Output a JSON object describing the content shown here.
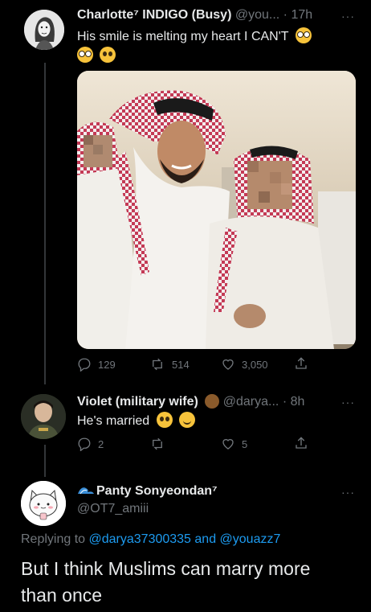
{
  "tweets": [
    {
      "author": "Charlotte⁷ INDIGO (Busy)",
      "handle": "@you...",
      "sep": "·",
      "time": "17h",
      "text": "His smile is melting my heart I CAN'T",
      "text_emojis": [
        "nerd-face",
        "nerd-face",
        "pleading-face"
      ],
      "has_photo": true,
      "actions": {
        "replies": "129",
        "retweets": "514",
        "likes": "3,050"
      }
    },
    {
      "author": "Violet (military wife)",
      "author_emoji": "bear-face",
      "handle": "@darya...",
      "sep": "·",
      "time": "8h",
      "text": "He's married",
      "text_emojis": [
        "pleading-face",
        "slightly-smiling-face"
      ],
      "actions": {
        "replies": "2",
        "retweets": "",
        "likes": "5"
      }
    },
    {
      "author": "Panty Sonyeondan⁷",
      "author_emoji": "water-wave",
      "handle": "@OT7_amiii",
      "replying_prefix": "Replying to",
      "replying_users": "@darya37300335 and @youazz7",
      "text_line1": "But I think Muslims can marry more",
      "text_line2": "than once"
    }
  ],
  "more_glyph": "···",
  "colors": {
    "background": "#000000",
    "text": "#e7e9ea",
    "muted": "#71767b",
    "link": "#1d9bf0",
    "thread": "#333639"
  }
}
